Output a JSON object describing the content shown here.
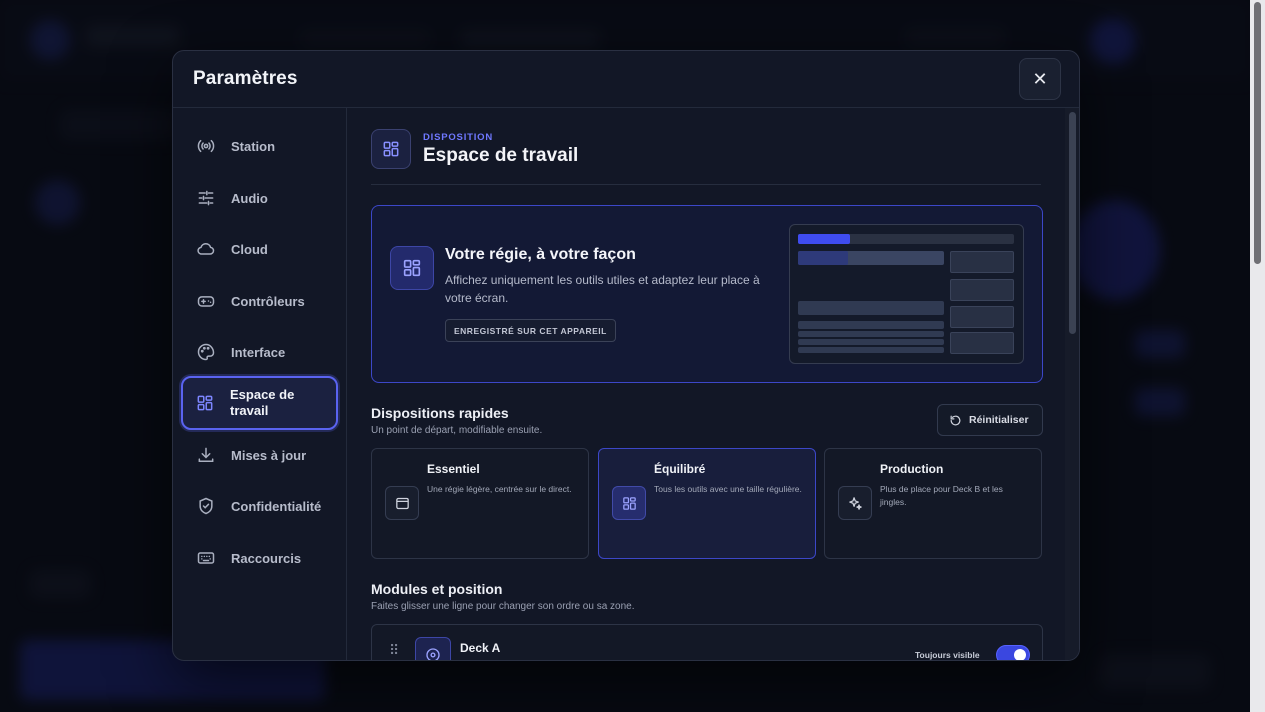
{
  "modal": {
    "title": "Paramètres",
    "close_label": "✕"
  },
  "sidebar": {
    "items": [
      {
        "label": "Station",
        "icon": "broadcast-icon"
      },
      {
        "label": "Audio",
        "icon": "sliders-icon"
      },
      {
        "label": "Cloud",
        "icon": "cloud-icon"
      },
      {
        "label": "Contrôleurs",
        "icon": "gamepad-icon"
      },
      {
        "label": "Interface",
        "icon": "palette-icon"
      },
      {
        "label": "Espace de travail",
        "icon": "layout-grid-icon",
        "active": true
      },
      {
        "label": "Mises à jour",
        "icon": "download-icon"
      },
      {
        "label": "Confidentialité",
        "icon": "shield-icon"
      },
      {
        "label": "Raccourcis",
        "icon": "keyboard-icon"
      }
    ]
  },
  "section": {
    "eyebrow": "DISPOSITION",
    "title": "Espace de travail"
  },
  "hero": {
    "title": "Votre régie, à votre façon",
    "description": "Affichez uniquement les outils utiles et adaptez leur place à votre écran.",
    "badge": "ENREGISTRÉ SUR CET APPAREIL"
  },
  "quick_layouts": {
    "title": "Dispositions rapides",
    "subtitle": "Un point de départ, modifiable ensuite.",
    "reset_label": "Réinitialiser",
    "cards": [
      {
        "title": "Essentiel",
        "description": "Une régie légère, centrée sur le direct.",
        "icon": "window-icon",
        "selected": false
      },
      {
        "title": "Équilibré",
        "description": "Tous les outils avec une taille régulière.",
        "icon": "layout-grid-icon",
        "selected": true
      },
      {
        "title": "Production",
        "description": "Plus de place pour Deck B et les jingles.",
        "icon": "sparkles-icon",
        "selected": false
      }
    ]
  },
  "modules": {
    "title": "Modules et position",
    "subtitle": "Faites glisser une ligne pour changer son ordre ou sa zone.",
    "rows": [
      {
        "title": "Deck A",
        "visibility_label": "Toujours visible",
        "enabled": true,
        "icon": "disc-icon"
      }
    ]
  },
  "colors": {
    "accent": "#5a63f0",
    "modal_bg": "#121726",
    "page_bg": "#0b0e17"
  }
}
